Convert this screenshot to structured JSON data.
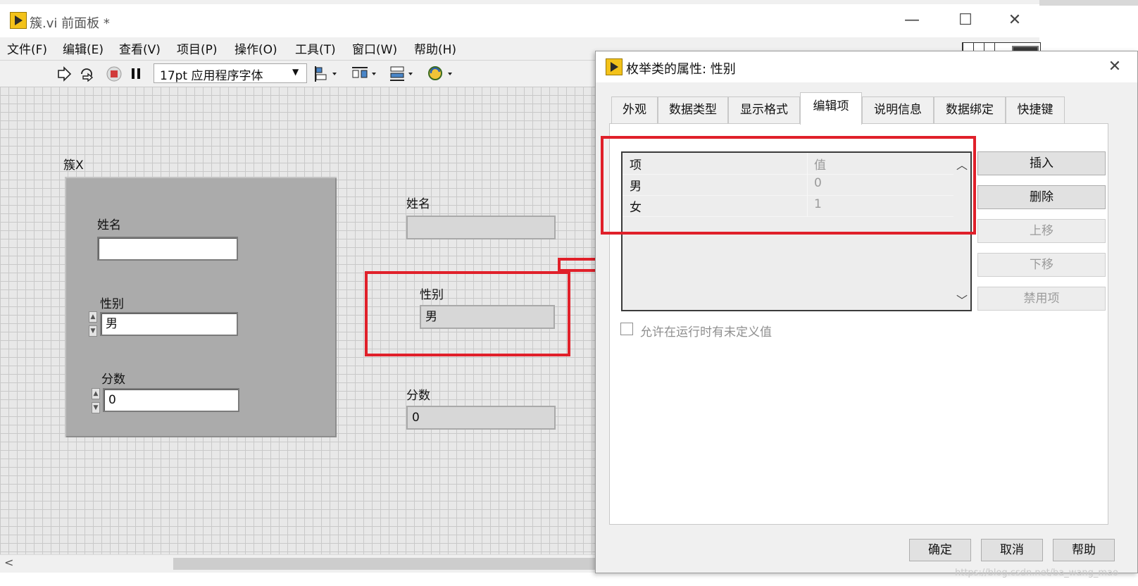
{
  "main_window": {
    "title": "簇.vi 前面板 *",
    "controls": {
      "minimize": "—",
      "maximize": "☐",
      "close": "✕"
    }
  },
  "menu": [
    "文件(F)",
    "编辑(E)",
    "查看(V)",
    "项目(P)",
    "操作(O)",
    "工具(T)",
    "窗口(W)",
    "帮助(H)"
  ],
  "toolbar": {
    "font": "17pt 应用程序字体",
    "font_arrow": "▼"
  },
  "front_panel": {
    "cluster": {
      "label": "簇X",
      "name_label": "姓名",
      "name_value": "",
      "gender_label": "性别",
      "gender_value": "男",
      "score_label": "分数",
      "score_value": "0"
    },
    "indicators": {
      "name_label": "姓名",
      "name_value": "",
      "gender_label": "性别",
      "gender_value": "男",
      "score_label": "分数",
      "score_value": "0"
    }
  },
  "scrollbar": {
    "left_arrow": "<"
  },
  "dialog": {
    "title": "枚举类的属性: 性别",
    "close": "✕",
    "tabs": [
      "外观",
      "数据类型",
      "显示格式",
      "编辑项",
      "说明信息",
      "数据绑定",
      "快捷键"
    ],
    "active_tab": "编辑项",
    "table": {
      "headers": [
        "项",
        "值"
      ],
      "rows": [
        {
          "item": "男",
          "value": "0"
        },
        {
          "item": "女",
          "value": "1"
        }
      ],
      "scroll_up": "︿",
      "scroll_down": "﹀"
    },
    "side_buttons": [
      {
        "label": "插入",
        "enabled": true
      },
      {
        "label": "删除",
        "enabled": true
      },
      {
        "label": "上移",
        "enabled": false
      },
      {
        "label": "下移",
        "enabled": false
      },
      {
        "label": "禁用项",
        "enabled": false
      }
    ],
    "checkbox_label": "允许在运行时有未定义值",
    "checkbox_checked": false,
    "buttons": {
      "ok": "确定",
      "cancel": "取消",
      "help": "帮助"
    }
  },
  "watermark": "https://blog.csdn.net/ba_wang_mao",
  "colors": {
    "annotation_red": "#e0202a",
    "labview_yellow": "#f3c21a"
  }
}
